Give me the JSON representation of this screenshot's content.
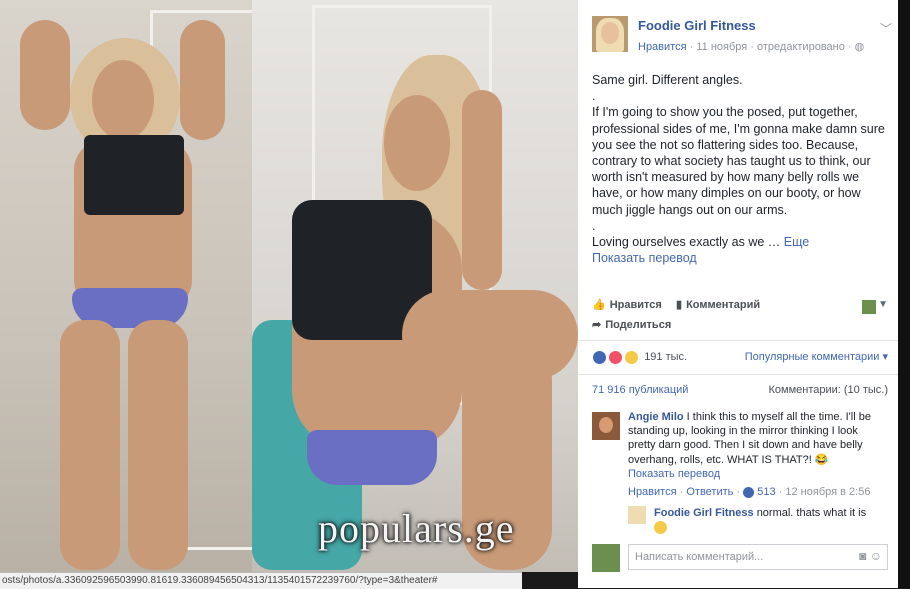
{
  "post": {
    "page_name": "Foodie Girl Fitness",
    "like_link": "Нравится",
    "date": "11 ноября",
    "edited": "отредактировано",
    "text_lines": [
      "Same girl. Different angles.",
      ".",
      "If I'm going to show you the posed, put together, professional sides of me, I'm gonna make damn sure you see the not so flattering sides too. Because, contrary to what society has taught us to think, our worth isn't measured by how many belly rolls we have, or how many dimples on our booty, or how much jiggle hangs out on our arms.",
      "."
    ],
    "last_line": "Loving ourselves exactly as we …",
    "more": "Еще",
    "translate": "Показать перевод"
  },
  "actions": {
    "like": "Нравится",
    "comment": "Комментарий",
    "share": "Поделиться"
  },
  "stats": {
    "reactions": "191 тыс.",
    "sort": "Популярные комментарии",
    "shares": "71 916 публикаций",
    "comments": "Комментарии: (10 тыс.)"
  },
  "comment": {
    "author": "Angie Milo",
    "text": "I think this to myself all the time. I'll be standing up, looking in the mirror thinking I look pretty darn good. Then I sit down and have belly overhang, rolls, etc. WHAT IS THAT?!",
    "translate": "Показать перевод",
    "like": "Нравится",
    "reply": "Ответить",
    "likes": "513",
    "time": "12 ноября в 2:56"
  },
  "reply": {
    "author": "Foodie Girl Fitness",
    "text": "normal. thats what it is"
  },
  "write_comment": {
    "placeholder": "Написать комментарий..."
  },
  "watermark": "populars.ge",
  "status_url": "osts/photos/a.336092596503990.81619.336089456504313/1135401572239760/?type=3&theater#",
  "colors": {
    "link": "#365899",
    "accent": "#4267b2"
  }
}
